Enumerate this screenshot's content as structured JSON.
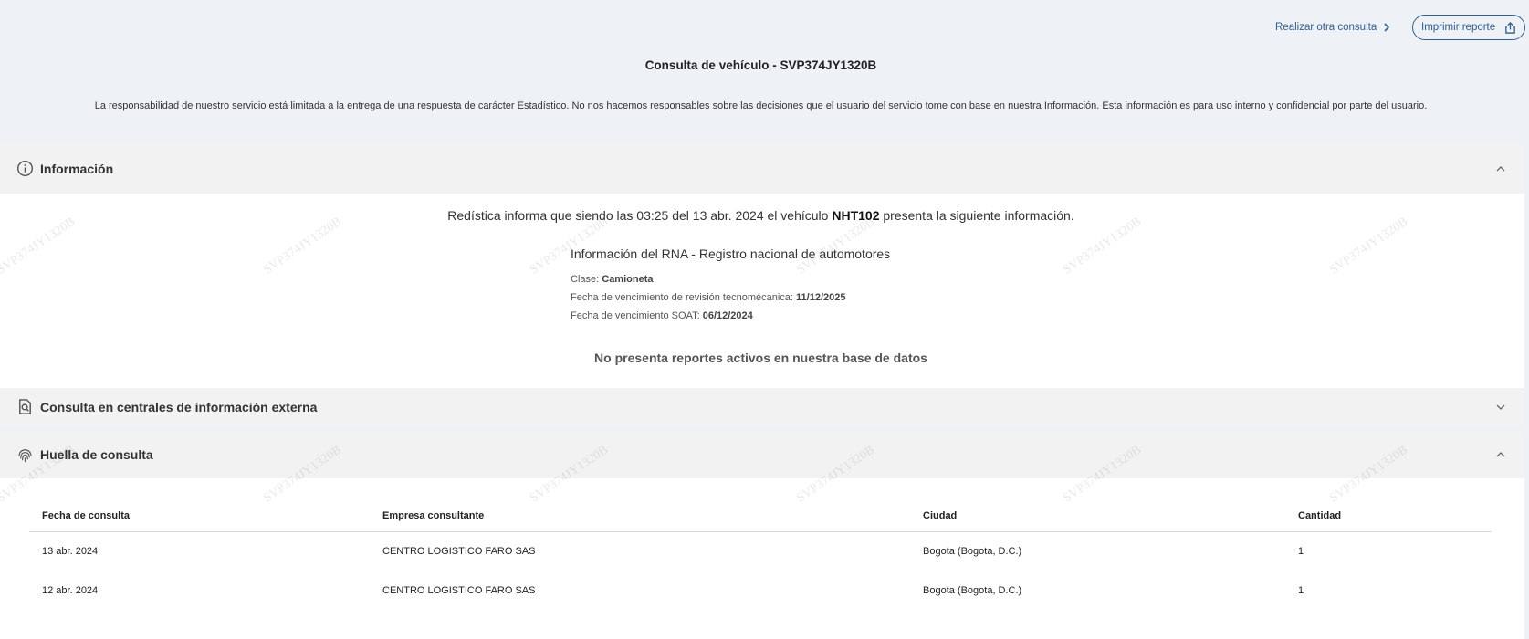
{
  "header": {
    "realizar_label": "Realizar otra consulta",
    "imprimir_label": "Imprimir reporte",
    "title": "Consulta de vehículo - SVP374JY1320B",
    "disclaimer": "La responsabilidad de nuestro servicio está limitada a la entrega de una respuesta de carácter Estadístico. No nos hacemos responsables sobre las decisiones que el usuario del servicio tome con base en nuestra Información. Esta información es para uso interno y confidencial por parte del usuario."
  },
  "sections": {
    "informacion": {
      "label": "Información",
      "intro_prefix": "Redística informa que siendo las 03:25 del 13 abr. 2024 el vehículo",
      "plate": "NHT102",
      "intro_suffix": "presenta la siguiente información.",
      "rna_title": "Información del RNA - Registro nacional de automotores",
      "clase_label": "Clase:",
      "clase_value": "Camioneta",
      "tecno_label": "Fecha de vencimiento de revisión tecnomécanica:",
      "tecno_value": "11/12/2025",
      "soat_label": "Fecha de vencimiento SOAT:",
      "soat_value": "06/12/2024",
      "no_reports": "No presenta reportes activos en nuestra base de datos"
    },
    "centrales": {
      "label": "Consulta en centrales de información externa"
    },
    "huella": {
      "label": "Huella de consulta",
      "columns": [
        "Fecha de consulta",
        "Empresa consultante",
        "Ciudad",
        "Cantidad"
      ],
      "rows": [
        [
          "13 abr. 2024",
          "CENTRO LOGISTICO FARO SAS",
          "Bogota (Bogota, D.C.)",
          "1"
        ],
        [
          "12 abr. 2024",
          "CENTRO LOGISTICO FARO SAS",
          "Bogota (Bogota, D.C.)",
          "1"
        ]
      ]
    }
  },
  "watermark": "SVP374JY1320B",
  "icons": {
    "chevron_right": "chevron-right-icon",
    "share": "share-icon",
    "info": "info-icon",
    "search_doc": "search-document-icon",
    "fingerprint": "fingerprint-icon",
    "chevron_up": "chevron-up-icon",
    "chevron_down": "chevron-down-icon"
  },
  "colors": {
    "link": "#2f5f8f",
    "page_bg": "#eef1f5",
    "section_bg": "#f2f2f2"
  }
}
